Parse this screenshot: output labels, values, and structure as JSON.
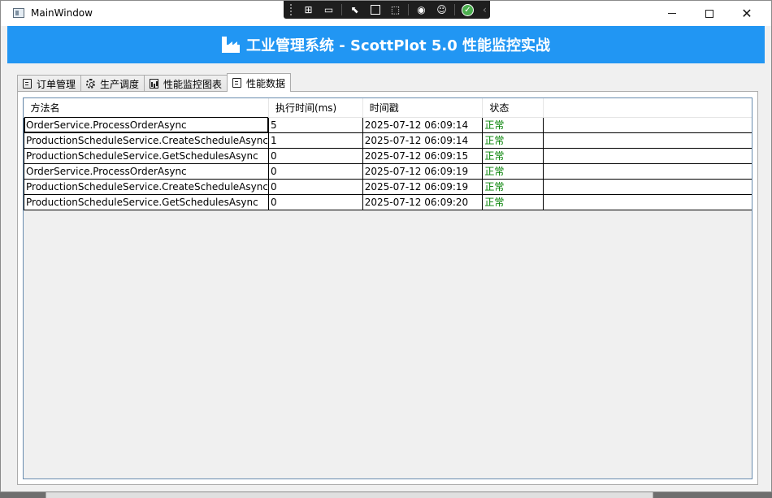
{
  "window": {
    "title": "MainWindow"
  },
  "devtools": {
    "icons": [
      "live-visual-tree-icon",
      "video-icon",
      "select-element-icon",
      "display-layout-adorners-icon",
      "track-focus-icon",
      "hot-reload-icon",
      "accessibility-icon",
      "binding-ok-icon",
      "collapse-icon"
    ]
  },
  "header": {
    "title": "工业管理系统 - ScottPlot 5.0 性能监控实战",
    "icon": "factory-icon"
  },
  "tabs": [
    {
      "label": "订单管理",
      "icon": "document-icon",
      "active": false
    },
    {
      "label": "生产调度",
      "icon": "gear-icon",
      "active": false
    },
    {
      "label": "性能监控图表",
      "icon": "bar-chart-icon",
      "active": false
    },
    {
      "label": "性能数据",
      "icon": "document-icon",
      "active": true
    }
  ],
  "grid": {
    "columns": [
      "方法名",
      "执行时间(ms)",
      "时间戳",
      "状态"
    ],
    "rows": [
      {
        "method": "OrderService.ProcessOrderAsync",
        "duration": "5",
        "timestamp": "2025-07-12 06:09:14",
        "status": "正常"
      },
      {
        "method": "ProductionScheduleService.CreateScheduleAsync",
        "duration": "1",
        "timestamp": "2025-07-12 06:09:14",
        "status": "正常"
      },
      {
        "method": "ProductionScheduleService.GetSchedulesAsync",
        "duration": "0",
        "timestamp": "2025-07-12 06:09:15",
        "status": "正常"
      },
      {
        "method": "OrderService.ProcessOrderAsync",
        "duration": "0",
        "timestamp": "2025-07-12 06:09:19",
        "status": "正常"
      },
      {
        "method": "ProductionScheduleService.CreateScheduleAsync",
        "duration": "0",
        "timestamp": "2025-07-12 06:09:19",
        "status": "正常"
      },
      {
        "method": "ProductionScheduleService.GetSchedulesAsync",
        "duration": "0",
        "timestamp": "2025-07-12 06:09:20",
        "status": "正常"
      }
    ],
    "status_color": "#008000"
  },
  "colors": {
    "header_bg": "#2196f3",
    "header_text": "#ffffff"
  }
}
